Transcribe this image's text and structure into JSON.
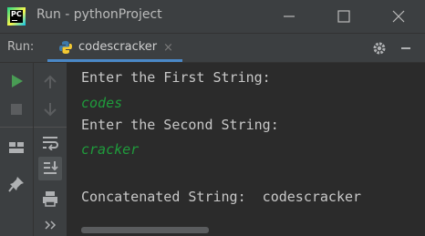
{
  "window": {
    "title": "Run - pythonProject",
    "logo_text": "PC"
  },
  "toolbar": {
    "run_label": "Run:",
    "tab_label": "codescracker",
    "tab_close": "×"
  },
  "console": {
    "lines": [
      {
        "text": "Enter the First String:",
        "kind": "output"
      },
      {
        "text": "codes",
        "kind": "input"
      },
      {
        "text": "Enter the Second String:",
        "kind": "output"
      },
      {
        "text": "cracker",
        "kind": "input"
      },
      {
        "text": "",
        "kind": "output"
      },
      {
        "text": "Concatenated String:  codescracker",
        "kind": "output"
      }
    ]
  },
  "colors": {
    "background": "#2b2b2b",
    "chrome": "#3c3f41",
    "output_text": "#c8c8c8",
    "input_text": "#1f9c3c",
    "tab_accent": "#4a88c7",
    "run_green": "#499c54"
  },
  "icons": {
    "left_toolbar": [
      "run-icon",
      "stop-icon",
      "layout-icon",
      "pin-icon"
    ],
    "right_toolbar": [
      "up-arrow-icon",
      "down-arrow-icon",
      "soft-wrap-icon",
      "scroll-to-end-icon",
      "print-icon",
      "more-icon"
    ],
    "header": [
      "gear-icon",
      "minimize-panel-icon"
    ]
  }
}
